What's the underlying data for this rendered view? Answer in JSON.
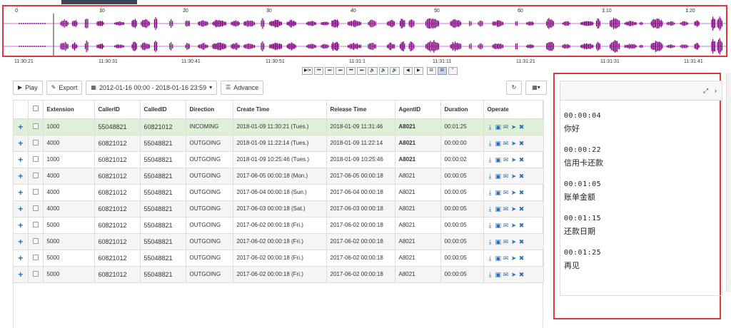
{
  "waveform": {
    "top_times": [
      "0",
      "10",
      "20",
      "30",
      "40",
      "50",
      "60",
      "1:10",
      "1:20"
    ],
    "bottom_times": [
      "11:30:21",
      "11:30:31",
      "11:30:41",
      "11:30:51",
      "11:31:1",
      "11:31:11",
      "11:31:21",
      "11:31:31",
      "11:31:41"
    ],
    "color": "#800080"
  },
  "player": {
    "buttons": [
      "▶/⏸",
      "⏮",
      "⏭",
      "⏭",
      "⏮",
      "⏭",
      "🔉",
      "🔉",
      "🔊",
      "◀",
      "▶",
      "⊟",
      "⊟",
      "⌃"
    ]
  },
  "toolbar": {
    "play_label": "Play",
    "export_label": "Export",
    "date_range": "2012-01-16 00:00 - 2018-01-16 23:59",
    "advance_label": "Advance"
  },
  "table": {
    "columns": [
      "",
      "",
      "Extension",
      "CallerID",
      "CalledID",
      "Direction",
      "Create Time",
      "Release Time",
      "AgentID",
      "Duration",
      "Operate"
    ],
    "rows": [
      {
        "ext": "1000",
        "caller": "55048821",
        "called": "60821012",
        "dir": "INCOMING",
        "create": "2018-01-09 11:30:21 (Tues.)",
        "release": "2018-01-09 11:31:46",
        "agent": "A8021",
        "dur": "00:01:25"
      },
      {
        "ext": "4000",
        "caller": "60821012",
        "called": "55048821",
        "dir": "OUTGOING",
        "create": "2018-01-09 11:22:14 (Tues.)",
        "release": "2018-01-09 11:22:14",
        "agent": "A8021",
        "dur": "00:00:00"
      },
      {
        "ext": "1000",
        "caller": "60821012",
        "called": "55048821",
        "dir": "OUTGOING",
        "create": "2018-01-09 10:25:46 (Tues.)",
        "release": "2018-01-09 10:25:46",
        "agent": "A8021",
        "dur": "00:00:02"
      },
      {
        "ext": "4000",
        "caller": "60821012",
        "called": "55048821",
        "dir": "OUTGOING",
        "create": "2017-06-05 00:00:18 (Mon.)",
        "release": "2017-06-05 00:00:18",
        "agent": "A8021",
        "dur": "00:00:05"
      },
      {
        "ext": "4000",
        "caller": "60821012",
        "called": "55048821",
        "dir": "OUTGOING",
        "create": "2017-06-04 00:00:18 (Sun.)",
        "release": "2017-06-04 00:00:18",
        "agent": "A8021",
        "dur": "00:00:05"
      },
      {
        "ext": "4000",
        "caller": "60821012",
        "called": "55048821",
        "dir": "OUTGOING",
        "create": "2017-06-03 00:00:18 (Sat.)",
        "release": "2017-06-03 00:00:18",
        "agent": "A8021",
        "dur": "00:00:05"
      },
      {
        "ext": "5000",
        "caller": "60821012",
        "called": "55048821",
        "dir": "OUTGOING",
        "create": "2017-06-02 00:00:18 (Fri.)",
        "release": "2017-06-02 00:00:18",
        "agent": "A8021",
        "dur": "00:00:05"
      },
      {
        "ext": "5000",
        "caller": "60821012",
        "called": "55048821",
        "dir": "OUTGOING",
        "create": "2017-06-02 00:00:18 (Fri.)",
        "release": "2017-06-02 00:00:18",
        "agent": "A8021",
        "dur": "00:00:05"
      },
      {
        "ext": "5000",
        "caller": "60821012",
        "called": "55048821",
        "dir": "OUTGOING",
        "create": "2017-06-02 00:00:18 (Fri.)",
        "release": "2017-06-02 00:00:18",
        "agent": "A8021",
        "dur": "00:00:05"
      },
      {
        "ext": "5000",
        "caller": "60821012",
        "called": "55048821",
        "dir": "OUTGOING",
        "create": "2017-06-02 00:00:18 (Fri.)",
        "release": "2017-06-02 00:00:18",
        "agent": "A8021",
        "dur": "00:00:05"
      }
    ]
  },
  "subtitles": [
    {
      "time": "00:00:04",
      "text": "你好"
    },
    {
      "time": "00:00:22",
      "text": "信用卡还款"
    },
    {
      "time": "00:01:05",
      "text": "账单金额"
    },
    {
      "time": "00:01:15",
      "text": "还款日期"
    },
    {
      "time": "00:01:25",
      "text": "再见"
    }
  ],
  "colors": {
    "accent": "#2e6fb7",
    "highlight_row": "#dff0d8",
    "border_red": "#e0383d"
  }
}
